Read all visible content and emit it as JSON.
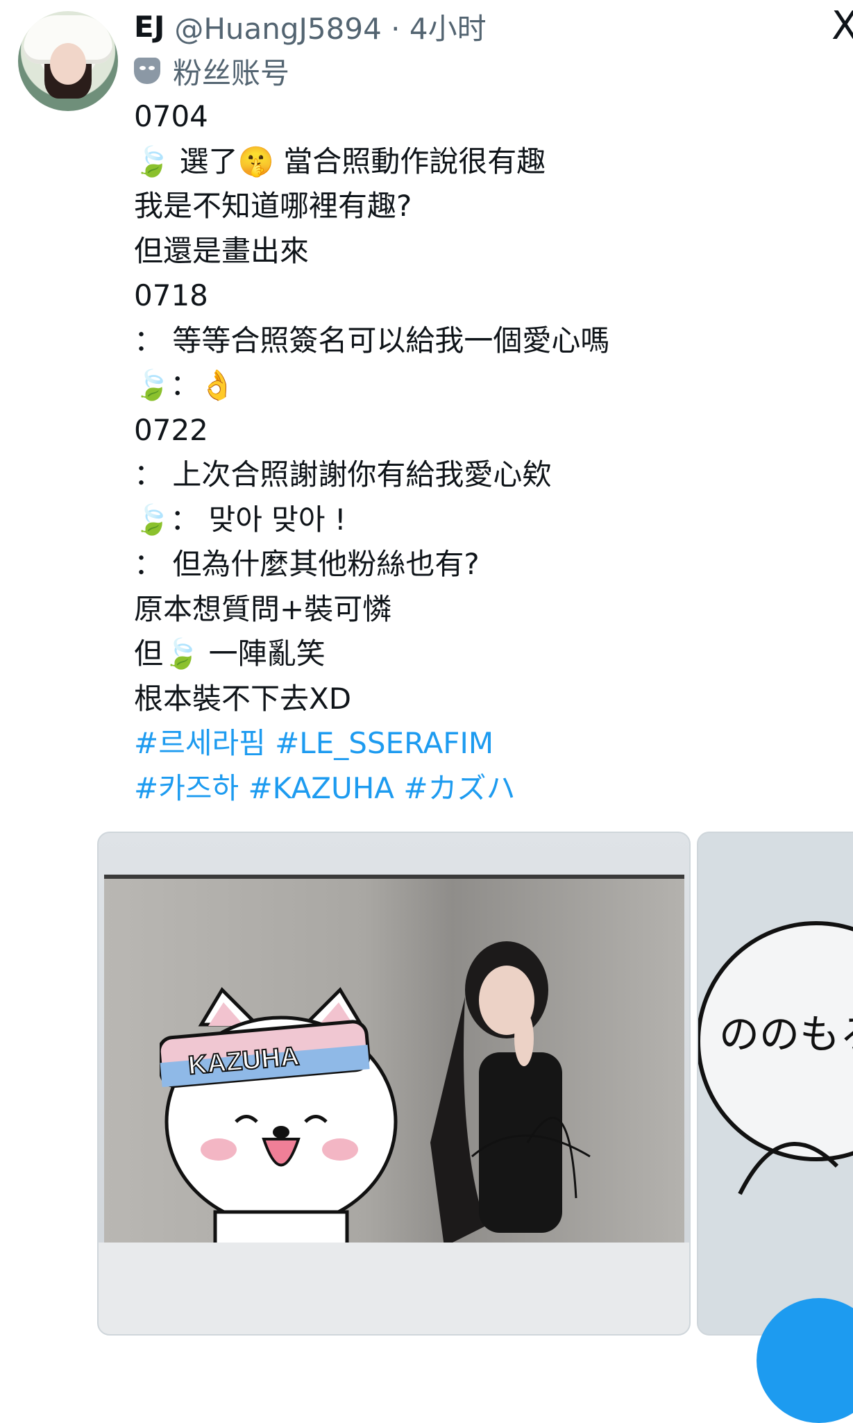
{
  "header": {
    "name": "EJ",
    "handle_time": "@HuangJ5894 · 4小时",
    "close_glyph": "X"
  },
  "fan_label": "粉丝账号",
  "icons": {
    "fan_badge": "theater-mask-icon",
    "leaf": "🍃",
    "shush": "🤫",
    "ok": "👌"
  },
  "tweet": {
    "lines": [
      "0704",
      "🍃 選了🤫 當合照動作說很有趣",
      "我是不知道哪裡有趣?",
      "但還是畫出來",
      "0718",
      "： 等等合照簽名可以給我一個愛心嗎",
      "🍃：👌",
      "0722",
      "： 上次合照謝謝你有給我愛心欸",
      "🍃： 맞아 맞아 !",
      "： 但為什麼其他粉絲也有?",
      "原本想質問+裝可憐",
      "但🍃 一陣亂笑",
      "根本裝不下去XD"
    ],
    "hashtag_lines": [
      "#르세라핌 #LE_SSERAFIM",
      "#카즈하 #KAZUHA #カズハ"
    ]
  },
  "media": {
    "photo1_headband": "KAZUHA",
    "photo2_text": "ののもろ"
  },
  "colors": {
    "text": "#0f1419",
    "muted": "#536471",
    "link": "#1d9bf0"
  }
}
